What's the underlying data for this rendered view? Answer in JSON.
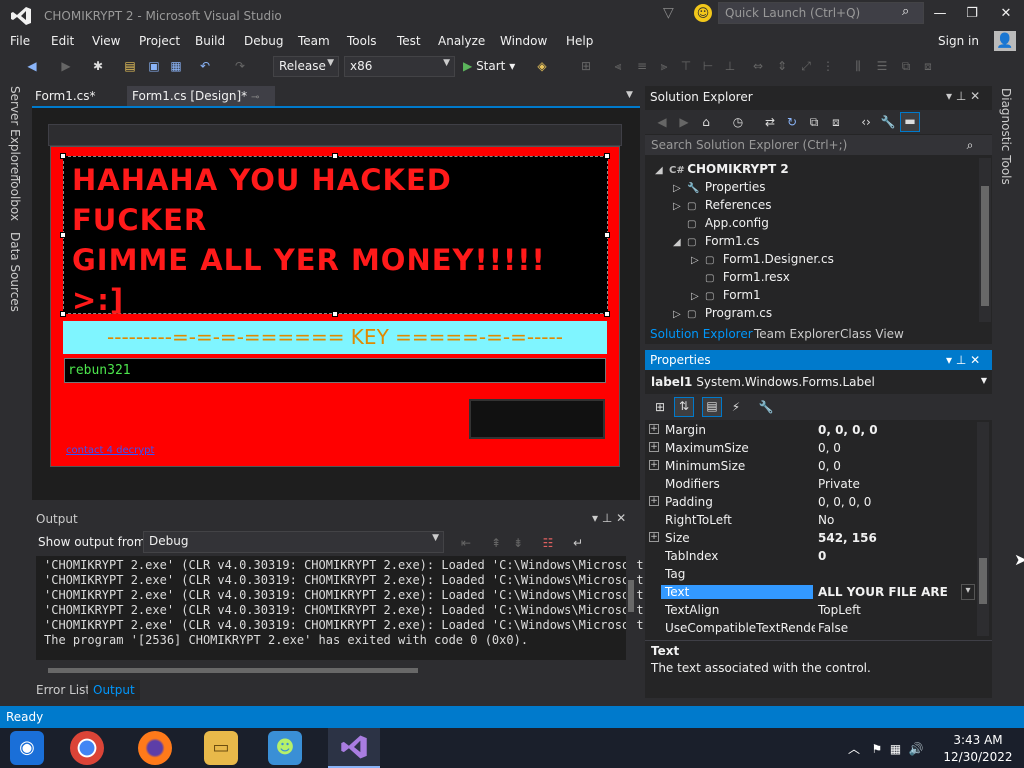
{
  "window": {
    "title": "CHOMIKRYPT 2 - Microsoft Visual Studio",
    "quick_launch_placeholder": "Quick Launch (Ctrl+Q)",
    "signin": "Sign in"
  },
  "menu": [
    "File",
    "Edit",
    "View",
    "Project",
    "Build",
    "Debug",
    "Team",
    "Tools",
    "Test",
    "Analyze",
    "Window",
    "Help"
  ],
  "toolbar": {
    "config": "Release",
    "platform": "x86",
    "start": "Start"
  },
  "side_tabs": [
    "Server Explorer",
    "Toolbox",
    "Data Sources"
  ],
  "right_tab": "Diagnostic Tools",
  "doc_tabs": [
    "Form1.cs*",
    "Form1.cs [Design]*"
  ],
  "designer": {
    "hack_line1": "HAHAHA YOU HACKED FUCKER",
    "hack_line2": "GIMME ALL YER MONEY!!!!! >:]",
    "key_banner": "---------=-=-=-====== KEY =====-=-=-----",
    "key_value": "rebun321",
    "contact_link": "contact 4 decrypt"
  },
  "output": {
    "title": "Output",
    "show_from_label": "Show output from:",
    "source": "Debug",
    "lines": [
      "'CHOMIKRYPT 2.exe' (CLR v4.0.30319: CHOMIKRYPT 2.exe): Loaded 'C:\\Windows\\Microsoft",
      "'CHOMIKRYPT 2.exe' (CLR v4.0.30319: CHOMIKRYPT 2.exe): Loaded 'C:\\Windows\\Microsoft",
      "'CHOMIKRYPT 2.exe' (CLR v4.0.30319: CHOMIKRYPT 2.exe): Loaded 'C:\\Windows\\Microsoft",
      "'CHOMIKRYPT 2.exe' (CLR v4.0.30319: CHOMIKRYPT 2.exe): Loaded 'C:\\Windows\\Microsoft",
      "'CHOMIKRYPT 2.exe' (CLR v4.0.30319: CHOMIKRYPT 2.exe): Loaded 'C:\\Windows\\Microsoft",
      "The program '[2536] CHOMIKRYPT 2.exe' has exited with code 0 (0x0)."
    ],
    "tabs": [
      "Error List",
      "Output"
    ]
  },
  "solution_explorer": {
    "title": "Solution Explorer",
    "search_placeholder": "Search Solution Explorer (Ctrl+;)",
    "tree": [
      {
        "label": "CHOMIKRYPT 2",
        "indent": 0,
        "exp": "open",
        "icon": "csharp-project-icon",
        "bold": true
      },
      {
        "label": "Properties",
        "indent": 1,
        "exp": "closed",
        "icon": "wrench-icon"
      },
      {
        "label": "References",
        "indent": 1,
        "exp": "closed",
        "icon": "references-icon"
      },
      {
        "label": "App.config",
        "indent": 1,
        "exp": "none",
        "icon": "config-file-icon"
      },
      {
        "label": "Form1.cs",
        "indent": 1,
        "exp": "open",
        "icon": "form-icon"
      },
      {
        "label": "Form1.Designer.cs",
        "indent": 2,
        "exp": "closed",
        "icon": "cs-file-icon"
      },
      {
        "label": "Form1.resx",
        "indent": 2,
        "exp": "none",
        "icon": "resx-file-icon"
      },
      {
        "label": "Form1",
        "indent": 2,
        "exp": "closed",
        "icon": "class-icon"
      },
      {
        "label": "Program.cs",
        "indent": 1,
        "exp": "closed",
        "icon": "cs-file-icon"
      }
    ],
    "tabs": [
      "Solution Explorer",
      "Team Explorer",
      "Class View"
    ]
  },
  "properties": {
    "title": "Properties",
    "object_name": "label1",
    "object_type": "System.Windows.Forms.Label",
    "rows": [
      {
        "name": "Margin",
        "value": "0, 0, 0, 0",
        "exp": true,
        "bold": true
      },
      {
        "name": "MaximumSize",
        "value": "0, 0",
        "exp": true
      },
      {
        "name": "MinimumSize",
        "value": "0, 0",
        "exp": true
      },
      {
        "name": "Modifiers",
        "value": "Private",
        "exp": false
      },
      {
        "name": "Padding",
        "value": "0, 0, 0, 0",
        "exp": true
      },
      {
        "name": "RightToLeft",
        "value": "No",
        "exp": false
      },
      {
        "name": "Size",
        "value": "542, 156",
        "exp": true,
        "bold": true
      },
      {
        "name": "TabIndex",
        "value": "0",
        "exp": false,
        "bold": true
      },
      {
        "name": "Tag",
        "value": "",
        "exp": false
      },
      {
        "name": "Text",
        "value": "ALL YOUR FILE ARE",
        "exp": false,
        "bold": true,
        "selected": true
      },
      {
        "name": "TextAlign",
        "value": "TopLeft",
        "exp": false
      },
      {
        "name": "UseCompatibleTextRenderi",
        "value": "False",
        "exp": false
      }
    ],
    "desc_title": "Text",
    "desc_text": "The text associated with the control."
  },
  "status": "Ready",
  "clock": {
    "time": "3:43 AM",
    "date": "12/30/2022"
  },
  "colors": {
    "accent": "#007acc",
    "form_bg": "#ff0000",
    "hack_text": "#ff1a1a",
    "key_bg": "#7ff5ff",
    "key_text": "#e08a00",
    "input_text": "#4ce54c"
  }
}
